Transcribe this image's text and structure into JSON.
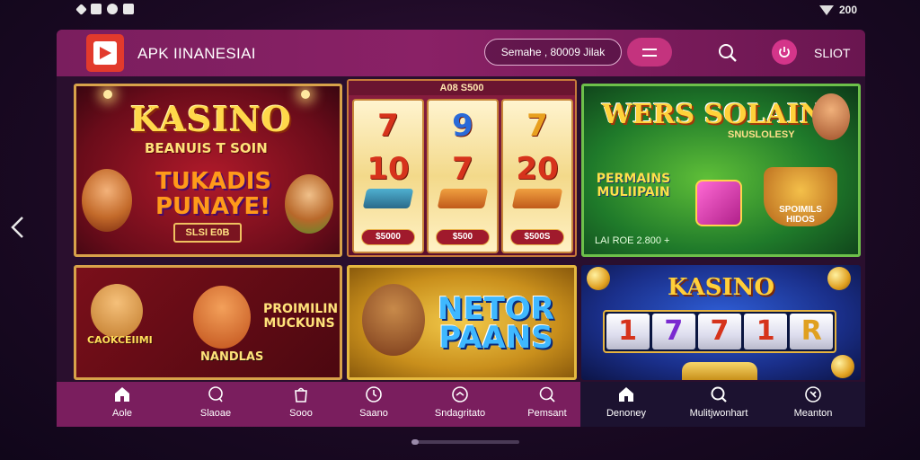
{
  "status_bar": {
    "time": "200"
  },
  "header": {
    "app_title": "APK IINANESIAI",
    "search_text": "Semahe , 80009 Jilak",
    "slot_label": "SLIOT"
  },
  "tiles": {
    "kasino": {
      "title": "KASINO",
      "subtitle": "BEANUIS T SOIN",
      "headline": "TUKADIS PUNAYE!",
      "plate": "SLSI E0B"
    },
    "reels": {
      "header": "A08 S500",
      "reel1": {
        "top": "7",
        "mid": "10",
        "price": "$5000"
      },
      "reel2": {
        "top": "9",
        "mid": "7",
        "price": "$500"
      },
      "reel3": {
        "top": "7",
        "mid": "20",
        "price": "$500S"
      }
    },
    "wers": {
      "title": "WERS SOLAING",
      "subtitle": "SNUSLOLESY",
      "left_badge": "PERMAINS MULIIPAIN",
      "right_badge": "SPOIMILS HIDOS",
      "footer": "LAI ROE 2.800 +"
    },
    "dogs": {
      "left_badge": "CAOKCEIIMI",
      "right_text": "PROIMILIN MUCKUNS",
      "bottom_text": "NANDLAS"
    },
    "netor": {
      "title": "NETOR PAANS"
    },
    "kasino2": {
      "title": "KASINO",
      "reels": [
        "1",
        "7",
        "7",
        "1",
        "R"
      ]
    }
  },
  "bottom_nav": {
    "items": [
      {
        "label": "Aole",
        "icon": "home-icon"
      },
      {
        "label": "Slaoae",
        "icon": "chat-icon"
      },
      {
        "label": "Sooo",
        "icon": "bag-icon"
      },
      {
        "label": "Saano",
        "icon": "clock-icon"
      },
      {
        "label": "Sndagritato",
        "icon": "gauge-icon"
      },
      {
        "label": "Pemsant",
        "icon": "search-icon"
      },
      {
        "label": "Denoney",
        "icon": "home-icon"
      },
      {
        "label": "Mulitjwonhart",
        "icon": "search-icon"
      },
      {
        "label": "Meanton",
        "icon": "compass-icon"
      }
    ]
  },
  "colors": {
    "header": "#8a2166",
    "accent": "#c4337e",
    "logo": "#e23a2c"
  }
}
